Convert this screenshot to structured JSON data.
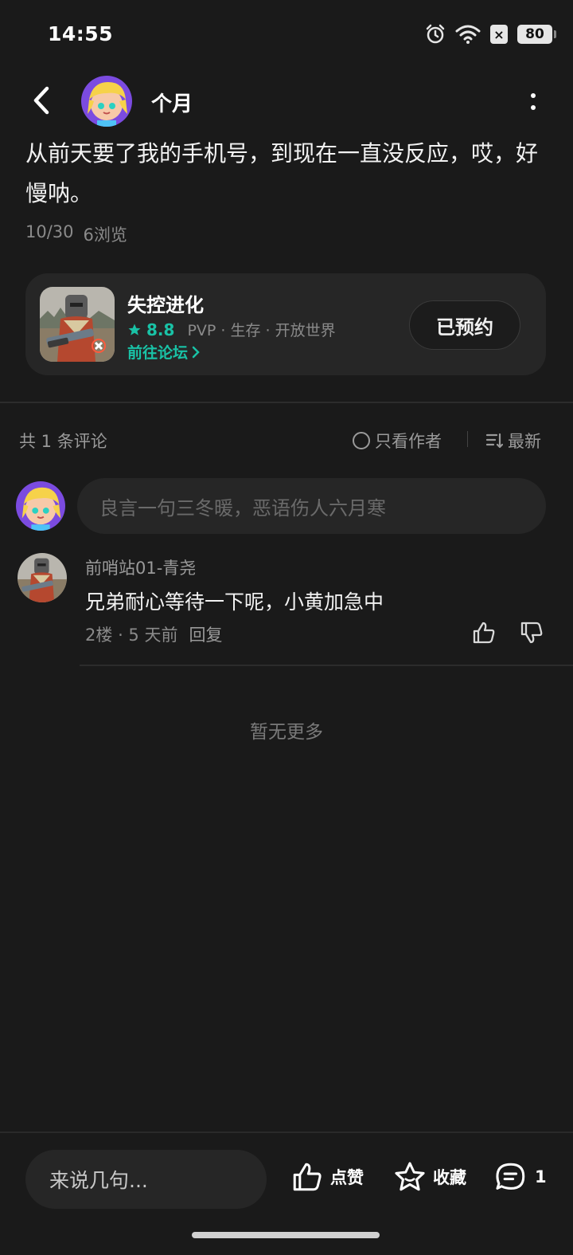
{
  "status_bar": {
    "time": "14:55",
    "battery": "80",
    "sim_label": "×"
  },
  "header": {
    "author": "个月"
  },
  "post": {
    "body": "从前天要了我的手机号，到现在一直没反应，哎，好慢呐。",
    "date": "10/30",
    "views": "6浏览"
  },
  "game_card": {
    "name": "失控进化",
    "rating": "8.8",
    "tags": "PVP · 生存 · 开放世界",
    "forum_link": "前往论坛",
    "reserve_label": "已预约"
  },
  "comments": {
    "count_label": "共 1 条评论",
    "only_author": "只看作者",
    "sort": "最新",
    "input_placeholder": "良言一句三冬暖，恶语伤人六月寒",
    "items": [
      {
        "user": "前哨站01-青尧",
        "text": "兄弟耐心等待一下呢，小黄加急中",
        "floor": "2楼",
        "time": "5 天前",
        "reply": "回复"
      }
    ],
    "no_more": "暂无更多"
  },
  "bottom_bar": {
    "input_placeholder": "来说几句...",
    "like_label": "点赞",
    "fav_label": "收藏",
    "comment_count": "1"
  },
  "colors": {
    "accent": "#19c2a6",
    "background": "#1a1a1a",
    "card": "#262626"
  }
}
